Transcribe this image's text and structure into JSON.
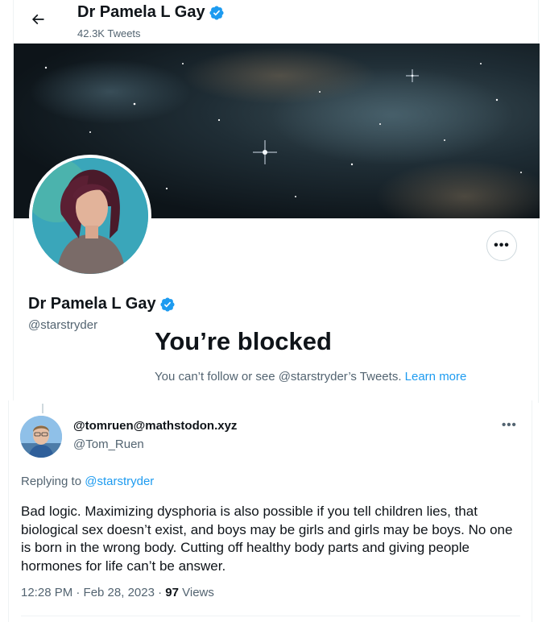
{
  "topbar": {
    "name": "Dr Pamela L Gay",
    "tweet_count": "42.3K Tweets"
  },
  "profile": {
    "display_name": "Dr Pamela L Gay",
    "handle": "@starstryder",
    "verified": true,
    "more_label": "•••"
  },
  "blocked": {
    "title": "You’re blocked",
    "description": "You can’t follow or see @starstryder’s Tweets.",
    "learn_more": "Learn more"
  },
  "tweet": {
    "author_name": "@tomruen@mathstodon.xyz",
    "author_handle": "@Tom_Ruen",
    "more_label": "•••",
    "replying_prefix": "Replying to",
    "replying_to": "@starstryder",
    "text": "Bad logic. Maximizing dysphoria is also possible if you tell children lies, that biological sex doesn’t exist, and boys may be girls and girls may be boys. No one is born in the wrong body. Cutting off healthy body parts and giving people hormones for life can’t be answer.",
    "time": "12:28 PM · Feb 28, 2023 ·",
    "views_count": "97",
    "views_label": "Views"
  },
  "colors": {
    "accent": "#1d9bf0",
    "secondary_text": "#536471",
    "primary_text": "#0f1419"
  }
}
